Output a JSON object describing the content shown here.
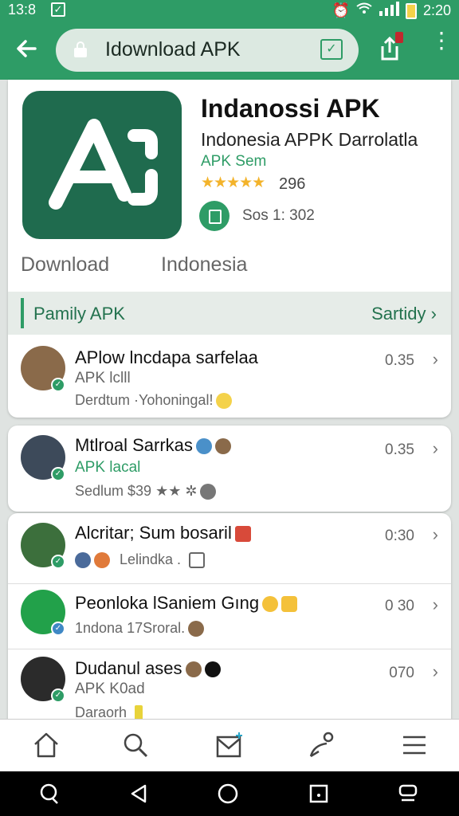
{
  "status_bar": {
    "time_left": "13:8",
    "time_right": "2:20",
    "check_icon": "checkbox-icon",
    "alarm_icon": "alarm-icon",
    "wifi_icon": "wifi-icon",
    "signal_icon": "signal-icon",
    "battery_icon": "battery-icon"
  },
  "browser": {
    "url": "Idownload APK",
    "back_icon": "back-arrow-icon",
    "lock_icon": "lock-icon",
    "tab_icon": "tab-switcher-icon",
    "share_icon": "share-icon",
    "menu_icon": "kebab-menu-icon"
  },
  "app": {
    "title": "Indanossi APK",
    "subtitle": "Indonesia APPK Darrolatla",
    "developer": "APK Sem",
    "stars": "★★★★★",
    "rating_count": "296",
    "size_text": "Sos 1: 302"
  },
  "tabs": [
    "Download",
    "Indonesia"
  ],
  "section": {
    "label": "Pamily APK",
    "more": "Sartidy",
    "chevron": "›"
  },
  "items": [
    {
      "title": "APlow lncdapa sarfelaa",
      "sub": "APK lclll",
      "meta": "Derdtum ·Yohoningal!",
      "value": "0.35"
    },
    {
      "title": "Mtlroal Sarrkas",
      "sub": "APK lacal",
      "meta": "Sedlum $39 ★★ ✲",
      "value": "0.35"
    },
    {
      "title": "Alcritar; Sum bosaril",
      "sub": "",
      "meta": "Lelindka .",
      "value": "0:30"
    },
    {
      "title": "Peonloka lSaniem Gıng",
      "sub": "",
      "meta": "1ndona 17Sroral.",
      "value": "0 30"
    },
    {
      "title": "Dudanul ases",
      "sub": "APK K0ad",
      "meta": "Daraorh",
      "value": "070"
    }
  ],
  "bottom_nav": [
    "home-icon",
    "search-icon",
    "inbox-icon",
    "profile-icon",
    "menu-icon"
  ],
  "colors": {
    "accent": "#2e9c66",
    "logo_bg": "#1f6b4e",
    "star": "#f3b32b"
  }
}
